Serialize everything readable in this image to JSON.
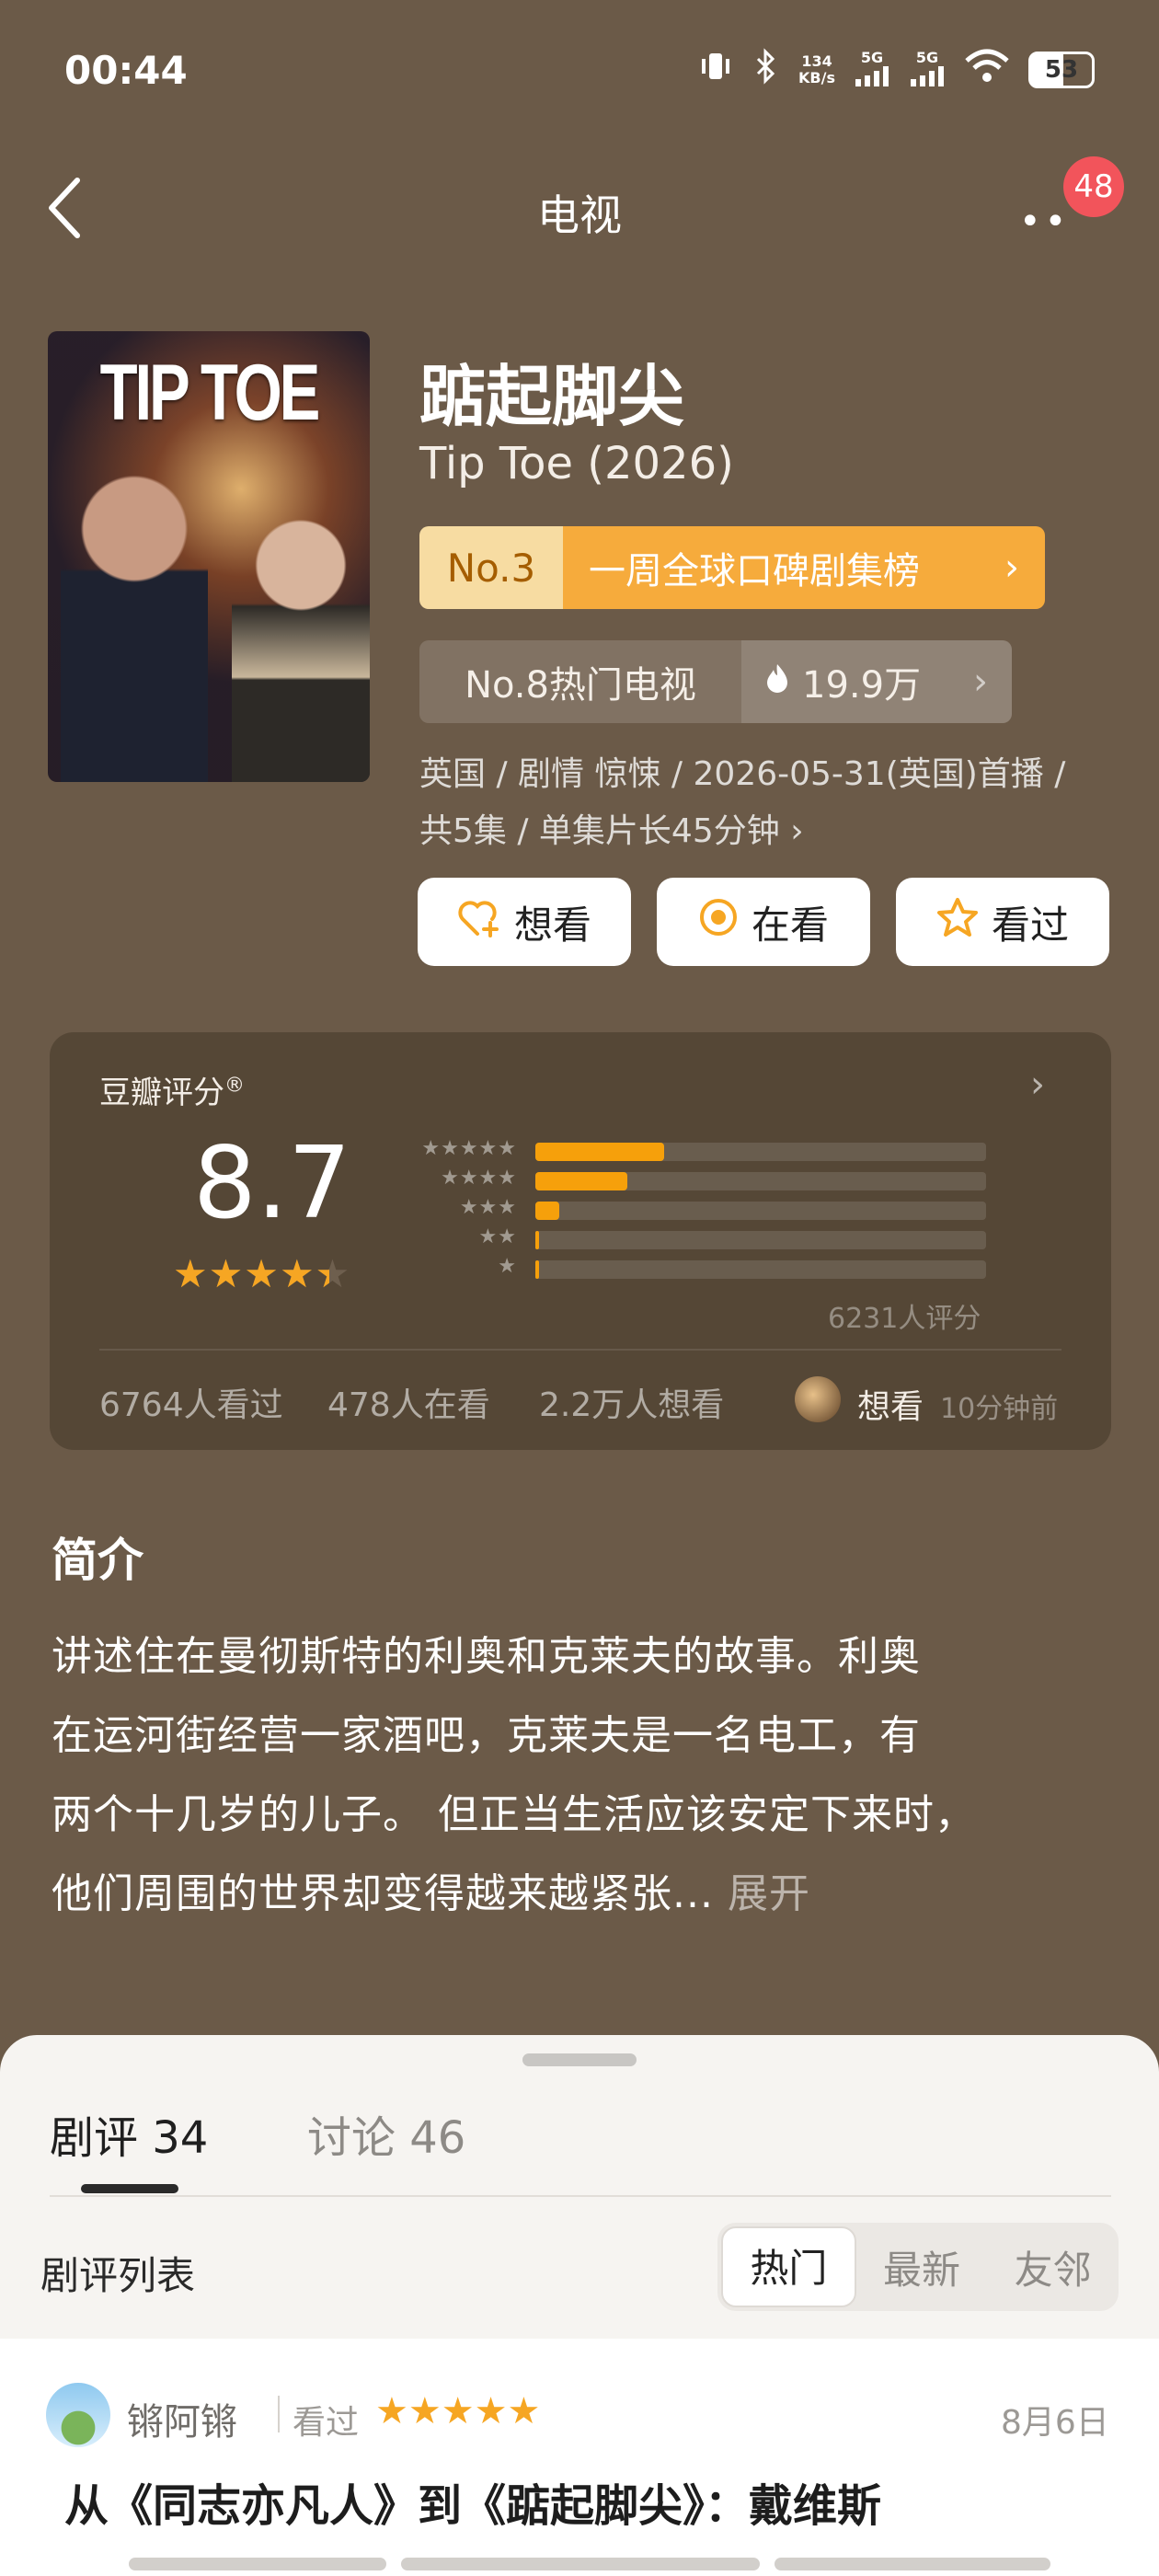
{
  "status_bar": {
    "time": "00:44",
    "net_speed_top": "134",
    "net_speed_bottom": "KB/s",
    "signal1": "5G",
    "signal2": "5G",
    "battery": "53"
  },
  "nav": {
    "title": "电视",
    "badge": "48"
  },
  "poster": {
    "title_text": "TIP TOE"
  },
  "show": {
    "title_cn": "踮起脚尖",
    "title_en": "Tip Toe (2026)",
    "rank_no": "No.3",
    "rank_label": "一周全球口碑剧集榜",
    "hot_no": "No.8热门电视",
    "heat": "19.9万",
    "meta_line1": "英国 / 剧情 惊悚 / 2026-05-31(英国)首播 /",
    "meta_line2": "共5集 / 单集片长45分钟"
  },
  "actions": {
    "want": "想看",
    "watching": "在看",
    "watched": "看过"
  },
  "rating": {
    "label": "豆瓣评分",
    "score": "8.7",
    "stars_display": "★★★★★",
    "votes": "6231人评分",
    "distribution": [
      {
        "stars": "★★★★★",
        "fraction": 0.285
      },
      {
        "stars": "★★★★",
        "fraction": 0.205
      },
      {
        "stars": "★★★",
        "fraction": 0.053
      },
      {
        "stars": "★★",
        "fraction": 0.007
      },
      {
        "stars": "★",
        "fraction": 0.004
      }
    ],
    "watched_count": "6764人看过",
    "watching_count": "478人在看",
    "want_count": "2.2万人想看",
    "friend_action": "想看",
    "friend_time": "10分钟前"
  },
  "synopsis": {
    "title": "简介",
    "lines": [
      "讲述住在曼彻斯特的利奥和克莱夫的故事。利奥",
      "在运河街经营一家酒吧，克莱夫是一名电工，有",
      "两个十几岁的儿子。 但正当生活应该安定下来时，",
      "他们周围的世界却变得越来越紧张..."
    ],
    "expand": "展开"
  },
  "sheet": {
    "tab_reviews": "剧评 34",
    "tab_discussions": "讨论 46",
    "list_label": "剧评列表",
    "segments": [
      "热门",
      "最新",
      "友邻"
    ]
  },
  "review": {
    "user": "锵阿锵",
    "status": "看过",
    "stars": "★★★★★",
    "date": "8月6日",
    "title": "从《同志亦凡人》到《踮起脚尖》：戴维斯"
  },
  "colors": {
    "background": "#6b5a48",
    "accent_orange": "#f6a623",
    "rank_bg": "#f6ab3c",
    "badge_red": "#f2545b"
  }
}
